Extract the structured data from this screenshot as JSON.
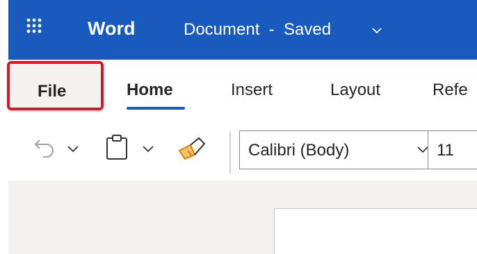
{
  "app": {
    "name": "Word",
    "document_title": "Document  -  Saved"
  },
  "ribbon": {
    "tabs": [
      {
        "label": "File",
        "highlighted": true
      },
      {
        "label": "Home",
        "selected": true
      },
      {
        "label": "Insert"
      },
      {
        "label": "Layout"
      },
      {
        "label": "Refe"
      }
    ]
  },
  "toolbar": {
    "font_name": "Calibri (Body)",
    "font_size": "11",
    "icons": [
      "undo-icon",
      "chevron-down-icon",
      "paste-icon",
      "chevron-down-icon",
      "format-painter-icon"
    ]
  },
  "colors": {
    "brand": "#185abd",
    "highlight": "#e8101c",
    "tab_hover": "#f3f2f1"
  }
}
